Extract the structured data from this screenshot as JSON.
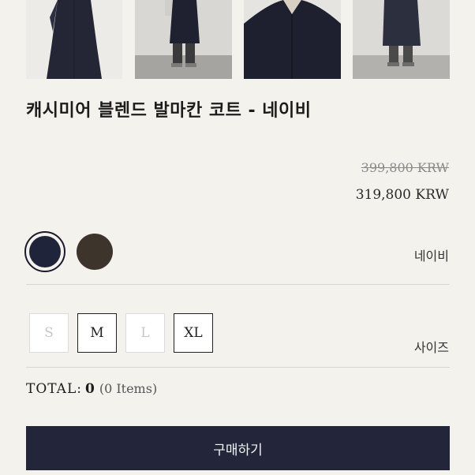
{
  "product": {
    "title": "캐시미어 블렌드 발마칸 코트 - 네이비",
    "original_price": "399,800 KRW",
    "sale_price": "319,800 KRW"
  },
  "gallery": {
    "images": [
      "coat-front-flat",
      "model-front-full",
      "collar-closeup",
      "model-side-full"
    ]
  },
  "colors": {
    "selected_label": "네이비",
    "options": [
      {
        "name": "navy",
        "hex": "#20243a",
        "selected": true
      },
      {
        "name": "brown",
        "hex": "#3d342b",
        "selected": false
      }
    ]
  },
  "sizes": {
    "label": "사이즈",
    "options": [
      {
        "label": "S",
        "available": false
      },
      {
        "label": "M",
        "available": true
      },
      {
        "label": "L",
        "available": false
      },
      {
        "label": "XL",
        "available": true
      }
    ]
  },
  "total": {
    "label": "TOTAL:",
    "value": "0",
    "items": "(0 Items)"
  },
  "buy_button": "구매하기"
}
